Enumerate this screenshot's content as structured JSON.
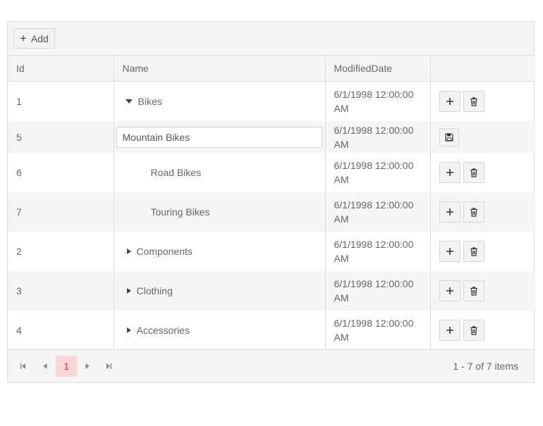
{
  "toolbar": {
    "add_label": "Add"
  },
  "columns": {
    "id": "Id",
    "name": "Name",
    "modified": "ModifiedDate"
  },
  "rows": [
    {
      "id": "1",
      "name": "Bikes",
      "modified": "6/1/1998 12:00:00 AM",
      "state": "expanded"
    },
    {
      "id": "5",
      "name": "Mountain Bikes",
      "modified": "6/1/1998 12:00:00 AM",
      "state": "editing"
    },
    {
      "id": "6",
      "name": "Road Bikes",
      "modified": "6/1/1998 12:00:00 AM",
      "state": "child"
    },
    {
      "id": "7",
      "name": "Touring Bikes",
      "modified": "6/1/1998 12:00:00 AM",
      "state": "child"
    },
    {
      "id": "2",
      "name": "Components",
      "modified": "6/1/1998 12:00:00 AM",
      "state": "collapsed"
    },
    {
      "id": "3",
      "name": "Clothing",
      "modified": "6/1/1998 12:00:00 AM",
      "state": "collapsed"
    },
    {
      "id": "4",
      "name": "Accessories",
      "modified": "6/1/1998 12:00:00 AM",
      "state": "collapsed"
    }
  ],
  "pager": {
    "current_page": "1",
    "info": "1 - 7 of 7 items"
  },
  "icons": {
    "add": "plus-icon",
    "delete": "trash-icon",
    "save": "save-icon",
    "expanded": "caret-down-icon",
    "collapsed": "caret-right-icon"
  },
  "colors": {
    "active_page_bg": "#fad6d6",
    "active_page_text": "#e8413c",
    "header_bg": "#f5f5f5",
    "border": "#dcdcdc"
  }
}
